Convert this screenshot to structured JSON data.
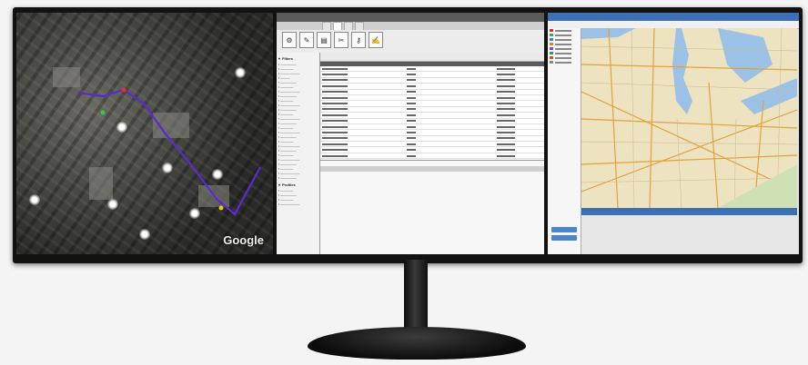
{
  "left_screen": {
    "map_logo": "Google",
    "route_color": "#5a2bd4"
  },
  "middle_screen": {
    "toolbar": {
      "tools": [
        "gear-icon",
        "wrench-icon",
        "chart-icon",
        "tools-icon",
        "key-icon",
        "edit-icon"
      ]
    },
    "tree": {
      "sections": [
        "Filters",
        "Profiles"
      ]
    },
    "accent": "#5a5a5a"
  },
  "right_screen": {
    "accent": "#3c6fb4",
    "side_colors": [
      "#c0392b",
      "#27ae60",
      "#2e86de",
      "#e67e22",
      "#8e44ad",
      "#16a085",
      "#d35400",
      "#7f8c8d"
    ]
  }
}
